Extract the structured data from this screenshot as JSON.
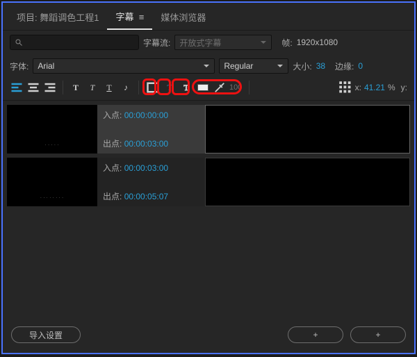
{
  "tabs": {
    "project": "项目: 舞蹈调色工程1",
    "captions": "字幕",
    "media_browser": "媒体浏览器"
  },
  "stream_row": {
    "search_placeholder": "",
    "stream_label": "字幕流:",
    "stream_value": "开放式字幕",
    "frame_label": "帧:",
    "frame_value": "1920x1080"
  },
  "font_row": {
    "font_label": "字体:",
    "font_value": "Arial",
    "weight_value": "Regular",
    "size_label": "大小:",
    "size_value": "38",
    "edge_label": "边缘:",
    "edge_value": "0"
  },
  "toolbar": {
    "opacity_value": "100",
    "x_label": "x:",
    "x_value": "41.21",
    "pct": "%",
    "y_label": "y:"
  },
  "clips": [
    {
      "thumb_text": "· · · · ·",
      "in_label": "入点:",
      "in_tc": "00:00:00:00",
      "out_label": "出点:",
      "out_tc": "00:00:03:00",
      "selected": true
    },
    {
      "thumb_text": "· · · · · · · ·",
      "in_label": "入点:",
      "in_tc": "00:00:03:00",
      "out_label": "出点:",
      "out_tc": "00:00:05:07",
      "selected": false
    }
  ],
  "footer": {
    "import_settings": "导入设置",
    "plus": "+"
  }
}
